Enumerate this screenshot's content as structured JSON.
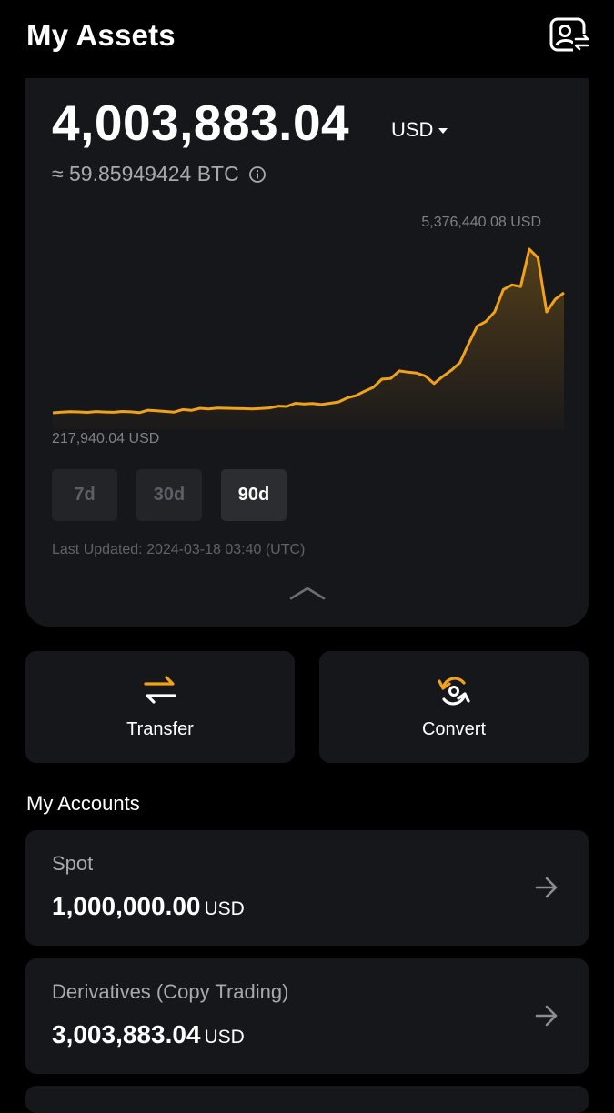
{
  "header": {
    "title": "My Assets",
    "icon": "account-switch-icon"
  },
  "overview": {
    "balance": "4,003,883.04",
    "currency": "USD",
    "btc_equivalent": "≈ 59.85949424 BTC",
    "chart_max_label": "5,376,440.08 USD",
    "chart_min_label": "217,940.04 USD",
    "ranges": [
      "7d",
      "30d",
      "90d"
    ],
    "selected_range": "90d",
    "last_updated": "Last Updated: 2024-03-18 03:40 (UTC)"
  },
  "chart_data": {
    "type": "area",
    "ylim": [
      217940.04,
      5376440.08
    ],
    "series": [
      {
        "values": [
          217940,
          240000,
          255000,
          248000,
          232000,
          258000,
          244000,
          236000,
          262000,
          250000,
          225000,
          300000,
          280000,
          262000,
          240000,
          320000,
          296000,
          360000,
          342000,
          370000,
          360000,
          355000,
          349000,
          340000,
          352000,
          372000,
          430000,
          418000,
          520000,
          500000,
          512000,
          478000,
          520000,
          560000,
          690000,
          760000,
          900000,
          1020000,
          1280000,
          1300000,
          1540000,
          1500000,
          1470000,
          1380000,
          1140000,
          1360000,
          1560000,
          1800000,
          2400000,
          2950000,
          3100000,
          3400000,
          4100000,
          4250000,
          4200000,
          5376440,
          5100000,
          3400000,
          3800000,
          4003883
        ]
      }
    ],
    "colors": {
      "line": "#f0a21a",
      "fill": "#f0a21a"
    }
  },
  "actions": [
    {
      "label": "Transfer",
      "icon": "transfer-icon"
    },
    {
      "label": "Convert",
      "icon": "convert-icon"
    }
  ],
  "accounts_title": "My Accounts",
  "accounts": [
    {
      "name": "Spot",
      "amount": "1,000,000.00",
      "currency": "USD"
    },
    {
      "name": "Derivatives (Copy Trading)",
      "amount": "3,003,883.04",
      "currency": "USD"
    }
  ],
  "colors": {
    "accent": "#f0a21a",
    "card": "#16171a",
    "background": "#000000"
  }
}
